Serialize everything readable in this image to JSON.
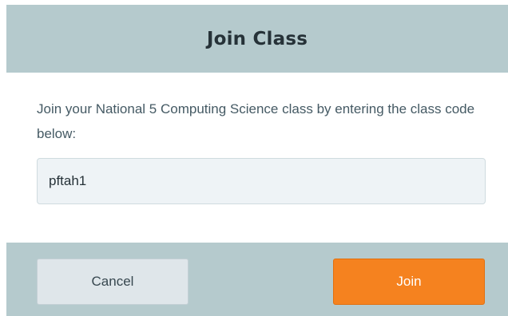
{
  "dialog": {
    "title": "Join Class",
    "instructions": "Join your National 5 Computing Science class by entering the class code below:",
    "code_input": {
      "value": "pftah1",
      "placeholder": ""
    },
    "buttons": {
      "cancel_label": "Cancel",
      "join_label": "Join"
    }
  },
  "colors": {
    "header_bg": "#b5cacd",
    "join_button": "#f5821f",
    "cancel_button": "#dfe6ea"
  }
}
